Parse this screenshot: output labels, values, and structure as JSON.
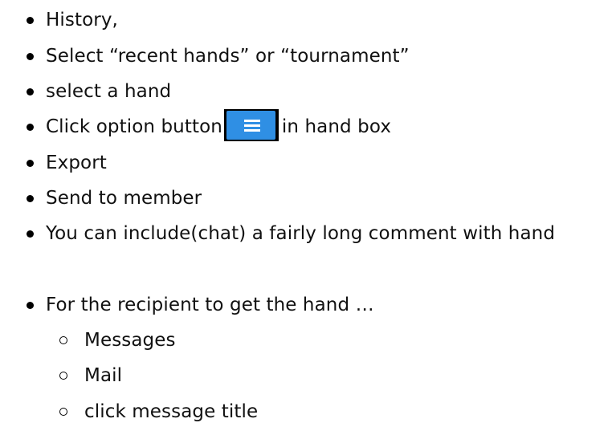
{
  "steps": [
    "History,",
    "Select “recent hands” or “tournament”",
    "select a hand",
    "Export",
    "Send to member",
    "You can include(chat) a fairly long comment with hand",
    "For the recipient to get the hand …"
  ],
  "option_step": {
    "before": "Click option button",
    "after": "in hand box",
    "button_icon": "hamburger-menu-icon",
    "button_color": "#2f8fe4"
  },
  "recipient_substeps": [
    "Messages",
    "Mail",
    "click message title"
  ]
}
